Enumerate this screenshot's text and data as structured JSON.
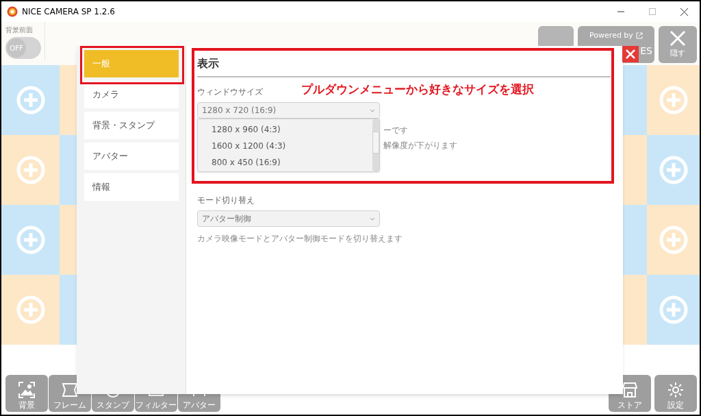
{
  "window": {
    "title": "NICE CAMERA SP 1.2.6"
  },
  "background_app": {
    "toggle": {
      "label": "背景前面",
      "value": "OFF",
      "on": false
    },
    "top_buttons": [
      {
        "kind": "home"
      },
      {
        "kind": "powered",
        "label": "Powered by",
        "sublabel": "ES"
      },
      {
        "kind": "hide",
        "label": "隠す"
      }
    ],
    "bottom_left": [
      {
        "kind": "image",
        "label": "背景"
      },
      {
        "kind": "frame",
        "label": "フレーム"
      },
      {
        "kind": "stamp",
        "label": "スタンプ"
      },
      {
        "kind": "filter",
        "label": "フィルター"
      },
      {
        "kind": "avatar",
        "label": "アバター"
      }
    ],
    "bottom_right": [
      {
        "kind": "store",
        "label": "ストア"
      },
      {
        "kind": "settings",
        "label": "設定"
      }
    ]
  },
  "settings_dialog": {
    "sidebar": [
      {
        "label": "一般",
        "selected": true
      },
      {
        "label": "カメラ",
        "selected": false
      },
      {
        "label": "背景・スタンプ",
        "selected": false
      },
      {
        "label": "アバター",
        "selected": false
      },
      {
        "label": "情報",
        "selected": false
      }
    ],
    "section_title": "表示",
    "window_size": {
      "label": "ウィンドウサイズ",
      "value": "1280 x 720 (16:9)",
      "expanded": true,
      "options": [
        "1280 x 960 (4:3)",
        "1600 x 1200 (4:3)",
        "800 x 450 (16:9)"
      ],
      "hint_fragments": [
        "ーです",
        "解像度が下がります"
      ]
    },
    "mode": {
      "label": "モード切り替え",
      "value": "アバター制御",
      "description": "カメラ映像モードとアバター制御モードを切り替えます"
    }
  },
  "annotation": "プルダウンメニューから好きなサイズを選択"
}
